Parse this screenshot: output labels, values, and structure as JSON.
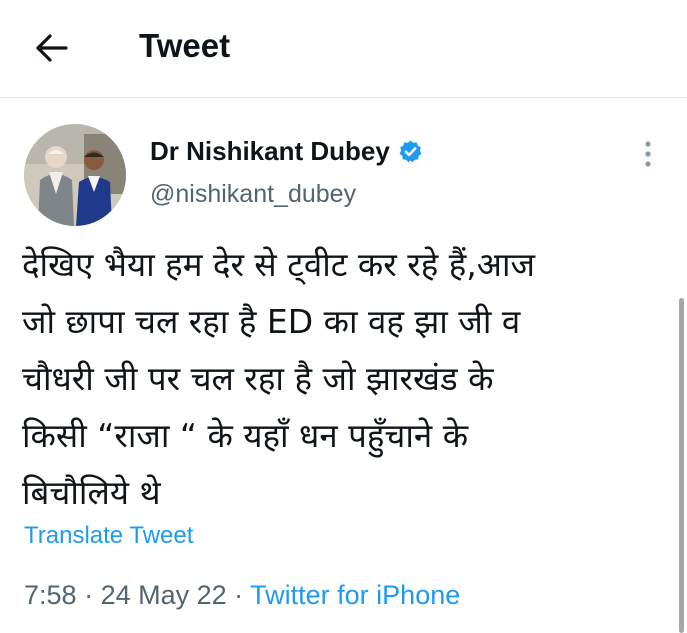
{
  "header": {
    "title": "Tweet",
    "back_icon": "arrow-left-icon"
  },
  "author": {
    "name": "Dr Nishikant Dubey",
    "handle": "@nishikant_dubey",
    "verified": true,
    "verified_icon": "verified-badge-icon"
  },
  "tweet": {
    "lines": [
      "देखिए भैया हम देर से ट्वीट कर रहे हैं,आज",
      "जो छापा चल रहा है ED का वह झा जी व",
      "चौधरी जी पर चल रहा है जो झारखंड के",
      "किसी “राजा “ के यहाँ धन पहुँचाने के",
      "बिचौलिये थे"
    ],
    "translate_label": "Translate Tweet",
    "time": "7:58",
    "date": "24 May 22",
    "source": "Twitter for iPhone",
    "separator": " · "
  },
  "colors": {
    "accent": "#1d9bf0",
    "text": "#0f1419",
    "muted": "#536471"
  }
}
